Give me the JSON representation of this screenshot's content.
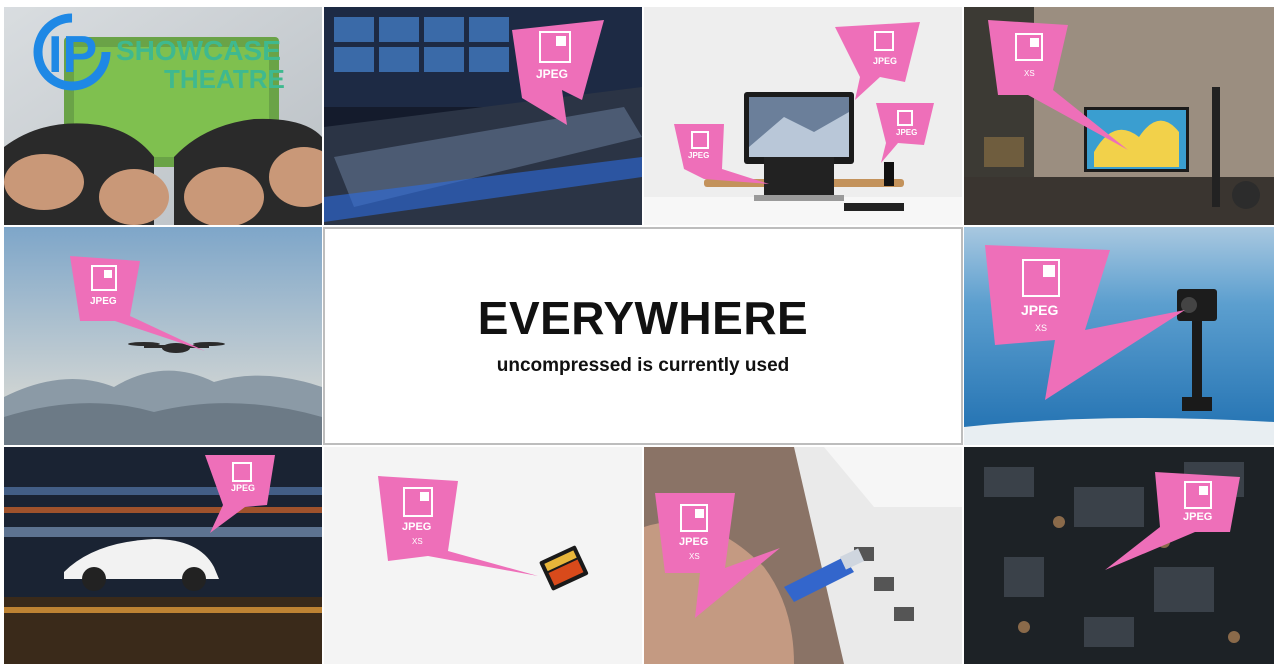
{
  "headline": "EVERYWHERE",
  "subheadline": "uncompressed is currently used",
  "logo": {
    "letters": "IP",
    "line1": "SHOWCASE",
    "line2": "THEATRE"
  },
  "badge": {
    "label": "JPEG",
    "sublabel": "XS"
  },
  "colors": {
    "badge_pink": "#ee6fb9",
    "logo_blue": "#1e88e5",
    "logo_green": "#3fb98f",
    "panel_border": "#bdbdbd"
  },
  "tiles": [
    {
      "name": "game-controller-photo"
    },
    {
      "name": "broadcast-control-room-photo"
    },
    {
      "name": "desktop-computer-photo"
    },
    {
      "name": "living-room-tv-photo"
    },
    {
      "name": "drone-photo"
    },
    {
      "name": "action-camera-photo"
    },
    {
      "name": "car-motion-photo"
    },
    {
      "name": "sd-card-photo"
    },
    {
      "name": "ethernet-cable-photo"
    },
    {
      "name": "circuit-board-photo"
    }
  ]
}
